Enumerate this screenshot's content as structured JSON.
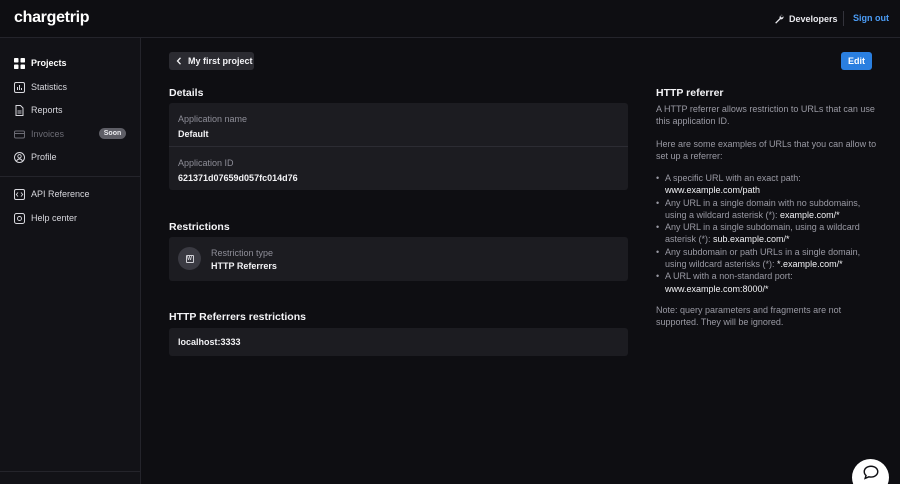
{
  "header": {
    "logo": "chargetrip",
    "developers_label": "Developers",
    "signout_label": "Sign out"
  },
  "sidebar": {
    "items": [
      {
        "label": "Projects",
        "icon": "grid-icon"
      },
      {
        "label": "Statistics",
        "icon": "chart-icon"
      },
      {
        "label": "Reports",
        "icon": "document-icon"
      },
      {
        "label": "Invoices",
        "icon": "invoice-icon",
        "badge": "Soon"
      },
      {
        "label": "Profile",
        "icon": "profile-icon"
      }
    ],
    "links": [
      {
        "label": "API Reference",
        "icon": "api-icon"
      },
      {
        "label": "Help center",
        "icon": "help-icon"
      }
    ]
  },
  "main": {
    "back_label": "My first project",
    "edit_label": "Edit",
    "details": {
      "title": "Details",
      "app_name_label": "Application name",
      "app_name_value": "Default",
      "app_id_label": "Application ID",
      "app_id_value": "621371d07659d057fc014d76"
    },
    "restrictions": {
      "title": "Restrictions",
      "type_label": "Restriction type",
      "type_value": "HTTP Referrers"
    },
    "referrers": {
      "title": "HTTP Referrers restrictions",
      "value": "localhost:3333"
    }
  },
  "help": {
    "title": "HTTP referrer",
    "intro": "A HTTP referrer allows restriction to URLs that can use this application ID.",
    "examples_intro": "Here are some examples of URLs that you can allow to set up a referrer:",
    "examples": [
      {
        "text": "A specific URL with an exact path: ",
        "code": "www.example.com/path"
      },
      {
        "text": "Any URL in a single domain with no subdomains, using a wildcard asterisk (*): ",
        "code": "example.com/*"
      },
      {
        "text": "Any URL in a single subdomain, using a wildcard asterisk (*): ",
        "code": "sub.example.com/*"
      },
      {
        "text": "Any subdomain or path URLs in a single domain, using wildcard asterisks (*): ",
        "code": "*.example.com/*"
      },
      {
        "text": "A URL with a non-standard port: ",
        "code": "www.example.com:8000/*"
      }
    ],
    "note": "Note: query parameters and fragments are not supported. They will be ignored."
  },
  "colors": {
    "background": "#0e0e12",
    "sidebar": "#121217",
    "card": "#1c1c21",
    "accent": "#2a7fe0",
    "link": "#4b9cf5"
  }
}
